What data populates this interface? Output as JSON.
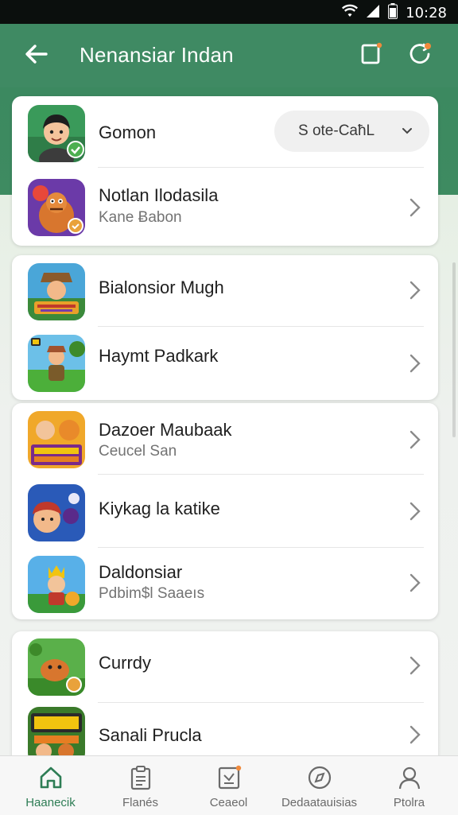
{
  "status_bar": {
    "time": "10:28",
    "icons": [
      "wifi-icon",
      "signal-icon",
      "battery-icon"
    ]
  },
  "app_bar": {
    "title": "Nenansiar Indan",
    "back_icon": "arrow-left-icon",
    "actions": [
      "square-icon",
      "refresh-icon"
    ],
    "notification_dot_color": "#f08a3c"
  },
  "colors": {
    "primary": "#3f8a63",
    "accent_badge": "#4caf50",
    "notification": "#f08a3c"
  },
  "cards": [
    {
      "rows": [
        {
          "title": "Gomon",
          "subtitle": "",
          "pill": {
            "label": "S ote-CaħL",
            "icon": "chevron-down-icon"
          },
          "icon": "cartoon-boy-app-icon",
          "badge": "check-badge"
        },
        {
          "title": "Notlan Ilodasila",
          "subtitle": "Kane Ƀabon",
          "icon": "monster-game-app-icon",
          "badge": "orange-check-badge"
        }
      ]
    },
    {
      "rows": [
        {
          "title": "Bialonsior Mugh",
          "subtitle": "",
          "icon": "cowboy-game-app-icon"
        },
        {
          "title": "Haymt Padkark",
          "subtitle": "",
          "icon": "explorer-game-app-icon"
        }
      ]
    },
    {
      "rows": [
        {
          "title": "Dazoer Maubaak",
          "subtitle": "Ceucel San",
          "icon": "puzzle-game-app-icon"
        },
        {
          "title": "Kiykag la katike",
          "subtitle": "",
          "icon": "pirate-game-app-icon"
        },
        {
          "title": "Daldonsiar",
          "subtitle": "Pdbim$l Saaeıs",
          "icon": "king-game-app-icon"
        }
      ]
    },
    {
      "rows": [
        {
          "title": "Currdy",
          "subtitle": "",
          "icon": "creature-game-app-icon"
        },
        {
          "title": "Sanali Prucla",
          "subtitle": "",
          "icon": "adventure-game-app-icon"
        }
      ]
    }
  ],
  "bottom_nav": [
    {
      "label": "Haanecik",
      "icon": "home-icon",
      "active": true
    },
    {
      "label": "Flanés",
      "icon": "clipboard-icon",
      "active": false
    },
    {
      "label": "Ceaeol",
      "icon": "note-icon",
      "active": false
    },
    {
      "label": "Dedaatauisias",
      "icon": "compass-icon",
      "active": false
    },
    {
      "label": "Ptolra",
      "icon": "person-icon",
      "active": false
    }
  ]
}
